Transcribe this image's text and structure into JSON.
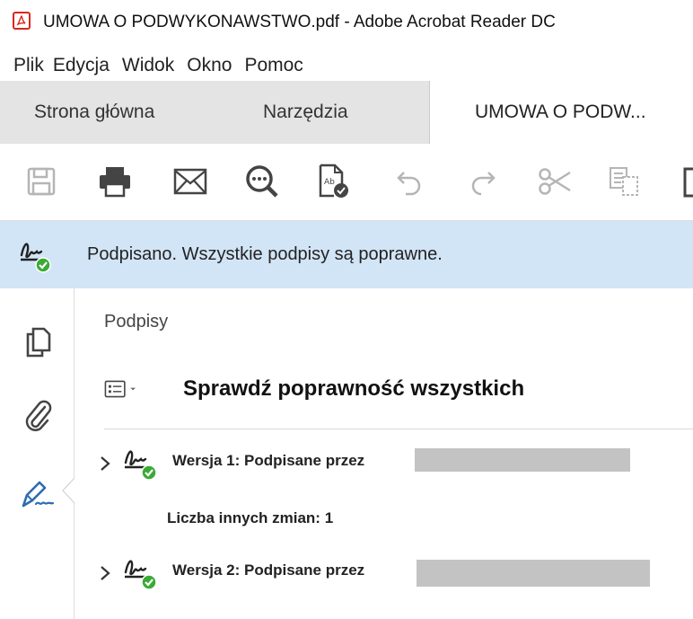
{
  "window": {
    "title": "UMOWA O PODWYKONAWSTWO.pdf - Adobe Acrobat Reader DC",
    "app_icon": "pdf-icon"
  },
  "menu": [
    "Plik",
    "Edycja",
    "Widok",
    "Okno",
    "Pomoc"
  ],
  "tabs": {
    "home": "Strona główna",
    "tools": "Narzędzia",
    "document": "UMOWA O PODW..."
  },
  "toolbar": [
    "save-icon",
    "print-icon",
    "email-icon",
    "zoom-icon",
    "spellcheck-icon",
    "undo-icon",
    "redo-icon",
    "cut-icon",
    "copy-icon",
    "paste-icon"
  ],
  "signature_bar": {
    "message": "Podpisano. Wszystkie podpisy są poprawne."
  },
  "signatures_panel": {
    "title": "Podpisy",
    "validate_all": "Sprawdź poprawność wszystkich",
    "versions": [
      {
        "label": "Wersja 1: Podpisane przez",
        "details": "Liczba innych zmian: 1"
      },
      {
        "label": "Wersja 2: Podpisane przez"
      }
    ]
  },
  "colors": {
    "signature_bar_bg": "#d2e5f6",
    "valid_green": "#3aaa35",
    "pen_blue": "#2b6cb0",
    "redaction_gray": "#c3c3c3"
  }
}
